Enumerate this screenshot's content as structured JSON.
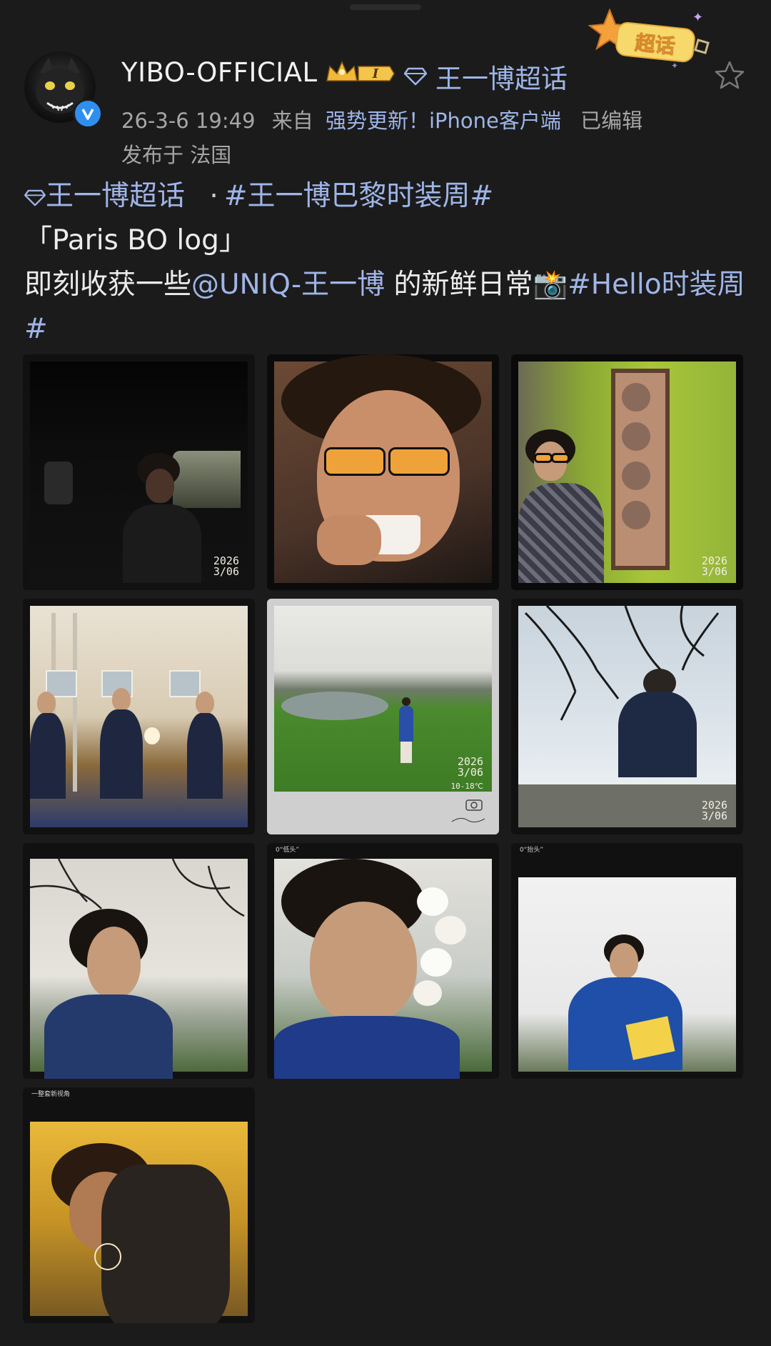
{
  "post": {
    "username": "YIBO-OFFICIAL",
    "vip_level": "I",
    "supertopic_link": "王一博超话",
    "timestamp": "26-3-6 19:49",
    "source_prefix": "来自",
    "source": "强势更新！iPhone客户端",
    "edited": "已编辑",
    "location": "发布于 法国",
    "badge_text": "超话"
  },
  "content": {
    "supertopic": "王一博超话",
    "separator": "·",
    "hashtag1": "#王一博巴黎时装周#",
    "line2": "「Paris BO log」",
    "line3_prefix": "即刻收获一些",
    "mention": "@UNIQ-王一博",
    "line3_mid": " 的新鲜日常",
    "camera_emoji": "📸",
    "hashtag2": "#Hello时装周#"
  },
  "photos": [
    {
      "stamp_year": "2026",
      "stamp_date": "3/06",
      "caption": ""
    },
    {
      "stamp_year": "",
      "stamp_date": "",
      "caption": ""
    },
    {
      "stamp_year": "2026",
      "stamp_date": "3/06",
      "caption": ""
    },
    {
      "stamp_year": "",
      "stamp_date": "",
      "caption": ""
    },
    {
      "stamp_year": "2026",
      "stamp_date": "3/06",
      "stamp_temp": "10-18℃",
      "caption": ""
    },
    {
      "stamp_year": "2026",
      "stamp_date": "3/06",
      "caption": ""
    },
    {
      "stamp_year": "",
      "stamp_date": "",
      "caption": ""
    },
    {
      "stamp_year": "",
      "stamp_date": "",
      "caption": "0“低头”"
    },
    {
      "stamp_year": "",
      "stamp_date": "",
      "caption": "0“抬头”"
    },
    {
      "stamp_year": "",
      "stamp_date": "",
      "caption": "一整套新视角"
    }
  ],
  "colors": {
    "background": "#1b1b1b",
    "link": "#9fb5e8",
    "verified": "#2f8ff0",
    "meta": "#a6a6a6"
  }
}
